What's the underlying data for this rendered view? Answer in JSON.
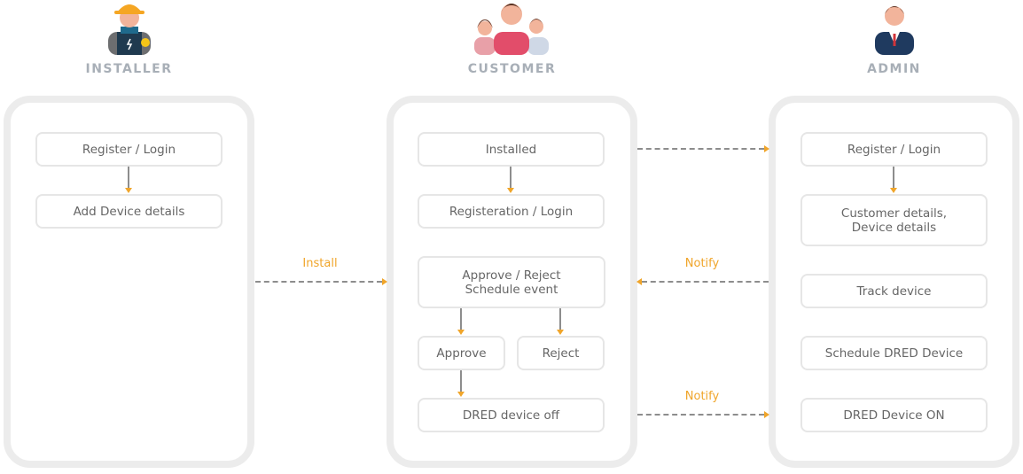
{
  "colors": {
    "accent": "#f0a52a",
    "title": "#a8afb7",
    "box_text": "#666666",
    "panel_border": "#ececec"
  },
  "columns": [
    {
      "title": "INSTALLER",
      "icon": "installer-icon",
      "steps": [
        "Register / Login",
        "Add Device details"
      ]
    },
    {
      "title": "CUSTOMER",
      "icon": "customer-group-icon",
      "steps": [
        "Installed",
        "Registeration / Login",
        "Approve / Reject\nSchedule event",
        "Approve",
        "Reject",
        "DRED device off"
      ]
    },
    {
      "title": "ADMIN",
      "icon": "admin-icon",
      "steps": [
        "Register / Login",
        "Customer details,\nDevice details",
        "Track device",
        "Schedule DRED Device",
        "DRED Device ON"
      ]
    }
  ],
  "connectors": [
    {
      "from": "INSTALLER",
      "to": "CUSTOMER",
      "label": "Install"
    },
    {
      "from": "CUSTOMER",
      "to": "ADMIN",
      "label": ""
    },
    {
      "from": "ADMIN",
      "to": "CUSTOMER",
      "label": "Notify"
    },
    {
      "from": "CUSTOMER",
      "to": "ADMIN",
      "label": "Notify"
    }
  ]
}
